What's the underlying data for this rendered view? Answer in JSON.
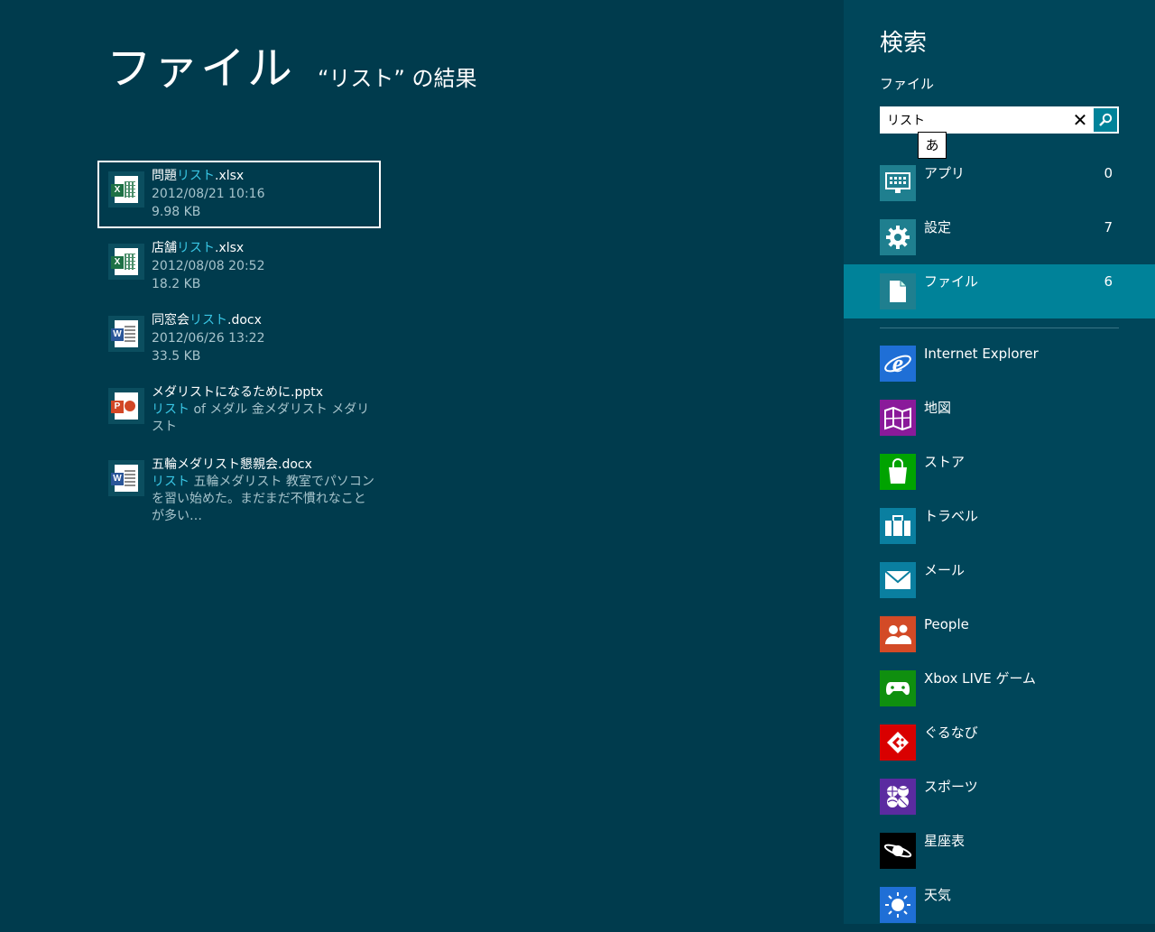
{
  "main": {
    "title": "ファイル",
    "subtitle": "“リスト” の結果",
    "results": [
      {
        "name_pre": "問題",
        "name_hl": "リスト",
        "name_post": ".xlsx",
        "line2": "2012/08/21 10:16",
        "line3": "9.98 KB",
        "icon": "excel-file-icon"
      },
      {
        "name_pre": "店舗",
        "name_hl": "リスト",
        "name_post": ".xlsx",
        "line2": "2012/08/08 20:52",
        "line3": "18.2 KB",
        "icon": "excel-file-icon"
      },
      {
        "name_pre": "同窓会",
        "name_hl": "リスト",
        "name_post": ".docx",
        "line2": "2012/06/26 13:22",
        "line3": "33.5 KB",
        "icon": "word-file-icon"
      },
      {
        "name": "メダリストになるために.pptx",
        "snippet_hl": "リスト",
        "snippet_rest": " of メダル 金メダリスト メダリスト",
        "icon": "powerpoint-file-icon"
      },
      {
        "name": "五輪メダリスト懇親会.docx",
        "snippet_hl": "リスト",
        "snippet_rest": " 五輪メダリスト 教室でパソコンを習い始めた。まだまだ不慣れなことが多い…",
        "icon": "word-file-icon"
      }
    ]
  },
  "charm": {
    "title": "検索",
    "scope_label": "ファイル",
    "search_value": "リスト",
    "ime_indicator": "あ",
    "categories": [
      {
        "label": "アプリ",
        "count": "0",
        "icon": "apps-icon",
        "color": "#1f7f8f"
      },
      {
        "label": "設定",
        "count": "7",
        "icon": "gear-icon",
        "color": "#1f7f8f"
      },
      {
        "label": "ファイル",
        "count": "6",
        "icon": "file-icon",
        "color": "#1f7f8f"
      }
    ],
    "apps": [
      {
        "label": "Internet Explorer",
        "icon": "internet-explorer-icon",
        "color": "#1f6fd6"
      },
      {
        "label": "地図",
        "icon": "maps-icon",
        "color": "#8a1a9a"
      },
      {
        "label": "ストア",
        "icon": "store-icon",
        "color": "#00a300"
      },
      {
        "label": "トラベル",
        "icon": "travel-icon",
        "color": "#0a7fa0"
      },
      {
        "label": "メール",
        "icon": "mail-icon",
        "color": "#0a7fa0"
      },
      {
        "label": "People",
        "icon": "people-icon",
        "color": "#d34a26"
      },
      {
        "label": "Xbox LIVE ゲーム",
        "icon": "xbox-games-icon",
        "color": "#0f8f0f"
      },
      {
        "label": "ぐるなび",
        "icon": "gurunavi-icon",
        "color": "#d90000"
      },
      {
        "label": "スポーツ",
        "icon": "sports-icon",
        "color": "#5b2ba0"
      },
      {
        "label": "星座表",
        "icon": "star-chart-icon",
        "color": "#000000"
      },
      {
        "label": "天気",
        "icon": "weather-icon",
        "color": "#1f6fd6"
      }
    ]
  }
}
